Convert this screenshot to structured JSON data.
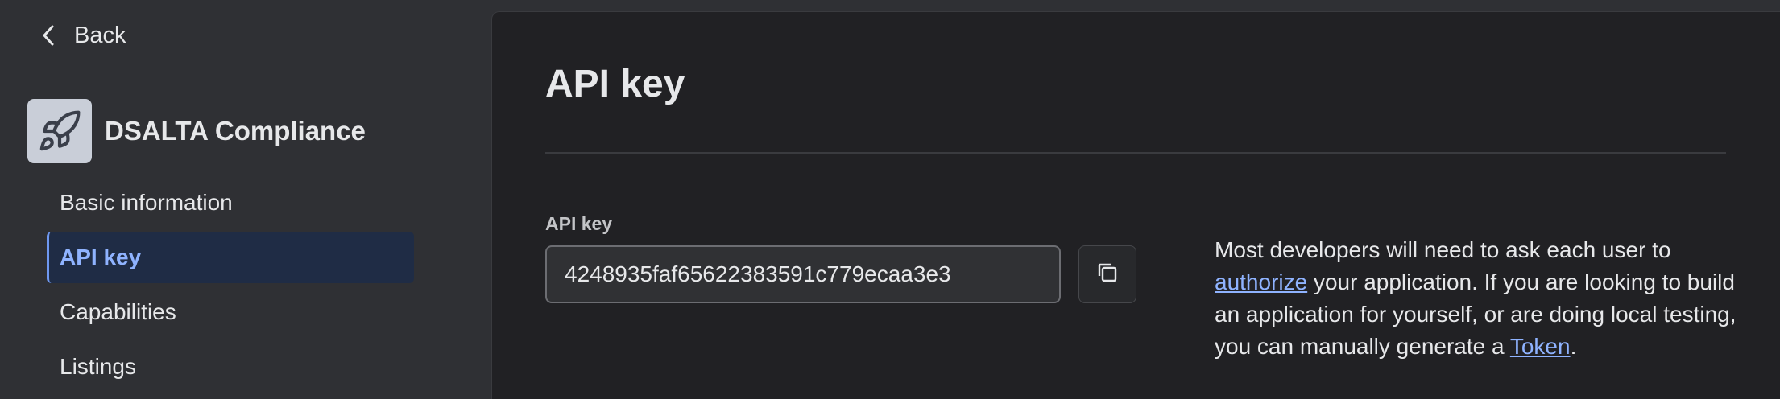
{
  "sidebar": {
    "back_label": "Back",
    "app": {
      "name": "DSALTA Compliance",
      "icon": "rocket-icon"
    },
    "items": [
      {
        "label": "Basic information",
        "active": false
      },
      {
        "label": "API key",
        "active": true
      },
      {
        "label": "Capabilities",
        "active": false
      },
      {
        "label": "Listings",
        "active": false
      }
    ]
  },
  "main": {
    "title": "API key",
    "api_key": {
      "label": "API key",
      "value": "4248935faf65622383591c779ecaa3e3",
      "copy_icon": "copy-icon"
    },
    "help": {
      "part1": "Most developers will need to ask each user to ",
      "link_authorize": "authorize",
      "part2": " your application. If you are looking to build an application for yourself, or are doing local testing, you can manually generate a ",
      "link_token": "Token",
      "part3": "."
    }
  },
  "colors": {
    "sidebar_bg": "#2f3034",
    "panel_bg": "#212124",
    "accent": "#8fb3ff",
    "active_item_bg": "#1f2c45"
  }
}
